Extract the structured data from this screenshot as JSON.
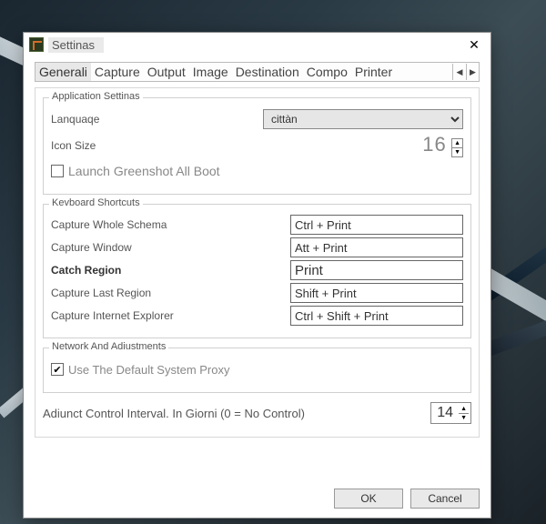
{
  "window": {
    "title": "Settinas"
  },
  "tabs": [
    "Generali",
    "Capture",
    "Output",
    "Image",
    "Destination",
    "Compo",
    "Printer"
  ],
  "activeTab": 0,
  "groups": {
    "app": {
      "title": "Application Settinas",
      "languageLabel": "Lanquaqe",
      "languageValue": "cittàn",
      "iconSizeLabel": "Icon Size",
      "iconSizeValue": "16",
      "launchBootLabel": "Launch Greenshot All Boot",
      "launchBootChecked": false
    },
    "shortcuts": {
      "title": "Kevboard Shortcuts",
      "rows": [
        {
          "label": "Capture Whole Schema",
          "value": "Ctrl + Print",
          "bold": false
        },
        {
          "label": "Capture Window",
          "value": "Att + Print",
          "bold": false
        },
        {
          "label": "Catch Region",
          "value": "Print",
          "bold": true
        },
        {
          "label": "Capture Last Region",
          "value": "Shift + Print",
          "bold": false
        },
        {
          "label": "Capture Internet Explorer",
          "value": "Ctrl + Shift + Print",
          "bold": false
        }
      ]
    },
    "network": {
      "title": "Network And Adiustments",
      "proxyLabel": "Use The Default System Proxy",
      "proxyChecked": true,
      "intervalLabel": "Adiunct Control Interval. In Giorni (0 = No Control)",
      "intervalValue": "14"
    }
  },
  "buttons": {
    "ok": "OK",
    "cancel": "Cancel"
  }
}
